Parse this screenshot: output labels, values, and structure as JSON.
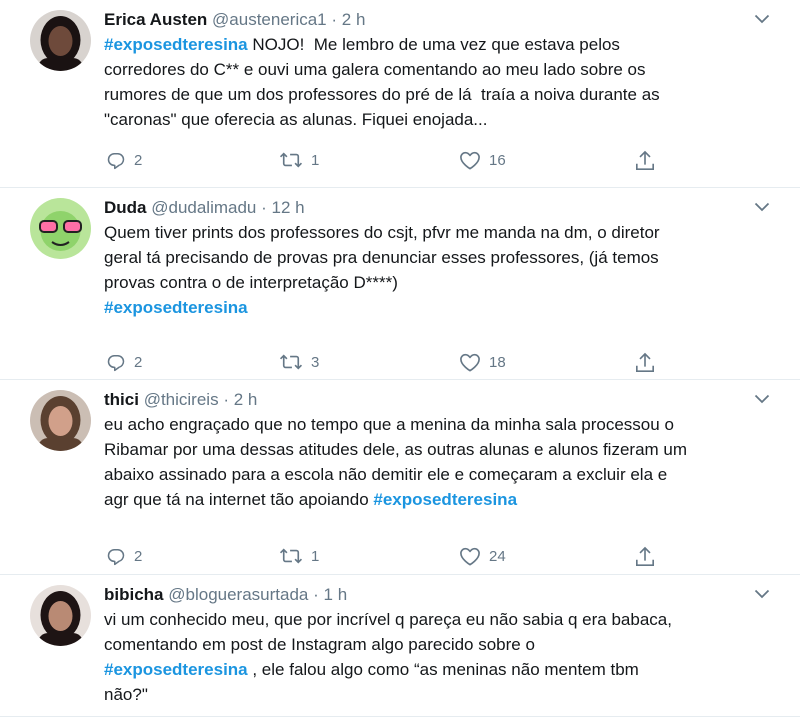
{
  "tweets": [
    {
      "name": "Erica Austen",
      "handle": "@austenerica1",
      "separator": "·",
      "time": "2 h",
      "lines": [
        [
          {
            "t": "#exposedteresina",
            "h": true
          },
          {
            "t": " NOJO!  Me lembro de uma vez que estava pelos"
          }
        ],
        [
          {
            "t": "corredores do C** e ouvi uma galera comentando ao meu lado sobre os"
          }
        ],
        [
          {
            "t": "rumores de que um dos professores do pré de lá  traía a noiva durante as"
          }
        ],
        [
          {
            "t": "\"caronas\" que oferecia as alunas. Fiquei enojada..."
          }
        ]
      ],
      "replies": "2",
      "retweets": "1",
      "likes": "16",
      "avatar_color": "#3a2a28"
    },
    {
      "name": "Duda",
      "handle": "@dudalimadu",
      "separator": "·",
      "time": "12 h",
      "lines": [
        [
          {
            "t": "Quem tiver prints dos professores do csjt, pfvr me manda na dm, o diretor"
          }
        ],
        [
          {
            "t": "geral tá precisando de provas pra denunciar esses professores, (já temos"
          }
        ],
        [
          {
            "t": "provas contra o de interpretação D****)"
          }
        ],
        [
          {
            "t": "#exposedteresina",
            "h": true
          }
        ]
      ],
      "replies": "2",
      "retweets": "3",
      "likes": "18",
      "avatar_color": "#8fd36b"
    },
    {
      "name": "thici",
      "handle": "@thicireis",
      "separator": "·",
      "time": "2 h",
      "lines": [
        [
          {
            "t": "eu acho engraçado que no tempo que a menina da minha sala processou o"
          }
        ],
        [
          {
            "t": "Ribamar por uma dessas atitudes dele, as outras alunas e alunos fizeram um"
          }
        ],
        [
          {
            "t": "abaixo assinado para a escola não demitir ele e começaram a excluir ela e"
          }
        ],
        [
          {
            "t": "agr que tá na internet tão apoiando "
          },
          {
            "t": "#exposedteresina",
            "h": true
          }
        ]
      ],
      "replies": "2",
      "retweets": "1",
      "likes": "24",
      "avatar_color": "#8a6a5a"
    },
    {
      "name": "bibicha",
      "handle": "@bloguerasurtada",
      "separator": "·",
      "time": "1 h",
      "lines": [
        [
          {
            "t": "vi um conhecido meu, que por incrível q pareça eu não sabia q era babaca,"
          }
        ],
        [
          {
            "t": "comentando em post de Instagram algo parecido sobre o"
          }
        ],
        [
          {
            "t": "#exposedteresina",
            "h": true
          },
          {
            "t": " , ele falou algo como “as meninas não mentem tbm"
          }
        ],
        [
          {
            "t": "não?\""
          }
        ]
      ],
      "replies": "",
      "retweets": "",
      "likes": "",
      "avatar_color": "#3b2624"
    }
  ],
  "colors": {
    "text": "#14171a",
    "secondary": "#657786",
    "hashtag": "#1b95e0",
    "divider": "#e6ecf0"
  },
  "icons": {
    "reply": "reply-icon",
    "retweet": "retweet-icon",
    "like": "like-icon",
    "share": "share-icon",
    "menu": "chevron-down-icon"
  }
}
